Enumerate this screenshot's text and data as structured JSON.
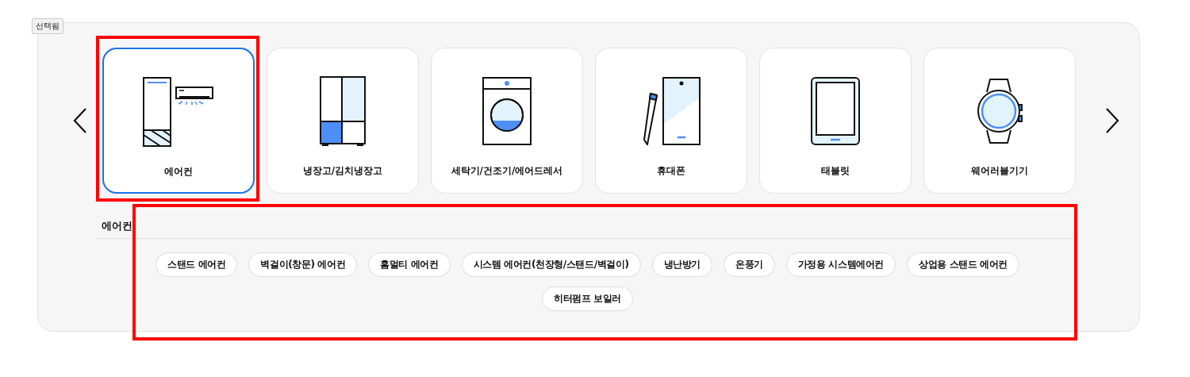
{
  "tag": {
    "label": "선택됨"
  },
  "categories": [
    {
      "kind": "ac",
      "label": "에어컨",
      "selected": true,
      "highlighted": true
    },
    {
      "kind": "fridge",
      "label": "냉장고/김치냉장고",
      "selected": false,
      "highlighted": false
    },
    {
      "kind": "washer",
      "label": "세탁기/건조기/에어드레서",
      "selected": false,
      "highlighted": false
    },
    {
      "kind": "phone",
      "label": "휴대폰",
      "selected": false,
      "highlighted": false
    },
    {
      "kind": "tablet",
      "label": "태블릿",
      "selected": false,
      "highlighted": false
    },
    {
      "kind": "watch",
      "label": "웨어러블기기",
      "selected": false,
      "highlighted": false
    }
  ],
  "subcategories": {
    "heading": "에어컨",
    "highlighted": true,
    "chips": [
      "스탠드 에어컨",
      "벽걸이(창문) 에어컨",
      "홈멀티 에어컨",
      "시스템 에어컨(천장형/스탠드/벽걸이)",
      "냉난방기",
      "온풍기",
      "가정용 시스템에어컨",
      "상업용 스탠드 에어컨",
      "히터펌프 보일러"
    ]
  }
}
